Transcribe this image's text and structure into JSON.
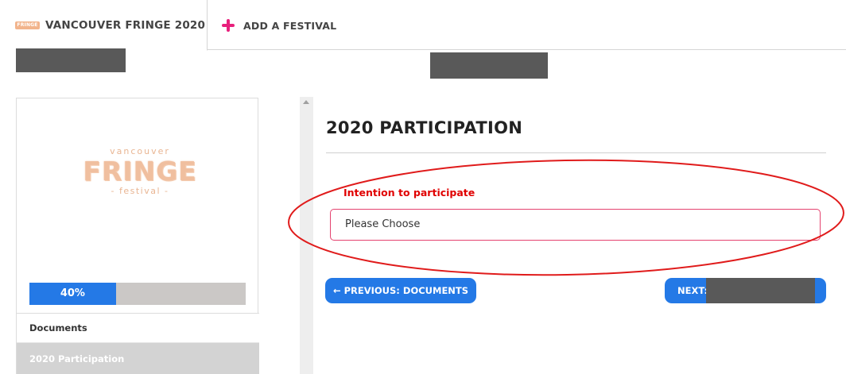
{
  "tabs": {
    "active": {
      "logo_text": "FRINGE",
      "label": "VANCOUVER FRINGE 2020"
    },
    "add": {
      "label": "ADD A FESTIVAL"
    }
  },
  "sidebar": {
    "logo": {
      "top": "vancouver",
      "main": "FRINGE",
      "bottom": "- festival -"
    },
    "progress": {
      "percent": 40,
      "label": "40%"
    },
    "nav": [
      {
        "label": "Documents",
        "active": false
      },
      {
        "label": "2020 Participation",
        "active": true
      }
    ]
  },
  "main": {
    "title": "2020 PARTICIPATION",
    "field": {
      "label": "Intention to participate",
      "value": "Please Choose"
    },
    "buttons": {
      "previous": "← PREVIOUS: DOCUMENTS",
      "next": "NEXT:"
    }
  },
  "colors": {
    "accent_blue": "#2479e6",
    "error_red": "#e00000",
    "add_plus": "#e8207c",
    "redaction": "#595959"
  }
}
